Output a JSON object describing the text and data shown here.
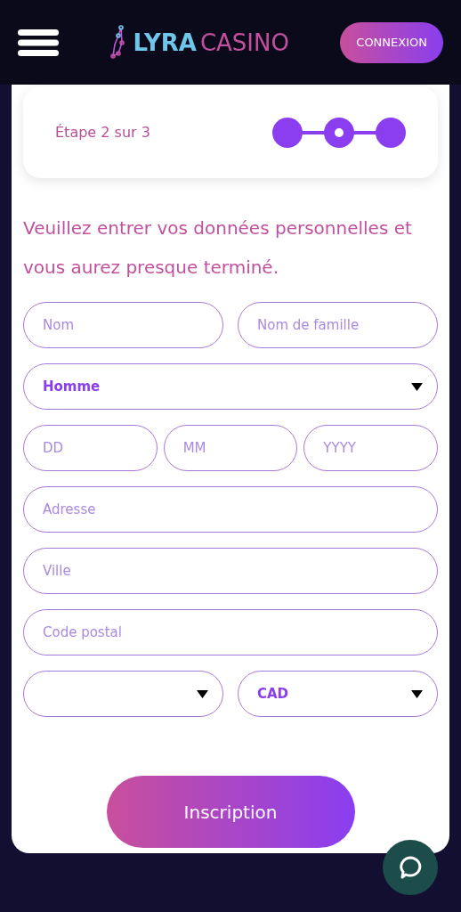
{
  "header": {
    "logo": {
      "part_1": "LYRA",
      "part_2": "CASINO"
    },
    "login_button": "CONNEXION"
  },
  "progress": {
    "label": "Étape 2 sur 3",
    "steps": [
      {
        "selected": false
      },
      {
        "selected": true
      },
      {
        "selected": false
      }
    ]
  },
  "heading": "Veuillez entrer vos données personnelles et vous aurez presque terminé.",
  "form_rows": [
    {
      "fields": [
        {
          "kind": "input",
          "placeholder": "Nom"
        },
        {
          "kind": "input",
          "placeholder": "Nom de famille"
        }
      ]
    },
    {
      "fields": [
        {
          "kind": "select",
          "value": "Homme"
        }
      ]
    },
    {
      "fields": [
        {
          "kind": "input",
          "placeholder": "DD"
        },
        {
          "kind": "input",
          "placeholder": "MM"
        },
        {
          "kind": "input",
          "placeholder": "YYYY"
        }
      ]
    },
    {
      "fields": [
        {
          "kind": "input",
          "placeholder": "Adresse"
        }
      ]
    },
    {
      "fields": [
        {
          "kind": "input",
          "placeholder": "Ville"
        }
      ]
    },
    {
      "fields": [
        {
          "kind": "input",
          "placeholder": "Code postal"
        }
      ]
    },
    {
      "fields": [
        {
          "kind": "select"
        },
        {
          "kind": "select",
          "value": "CAD"
        }
      ]
    }
  ],
  "submit_button": "Inscription"
}
